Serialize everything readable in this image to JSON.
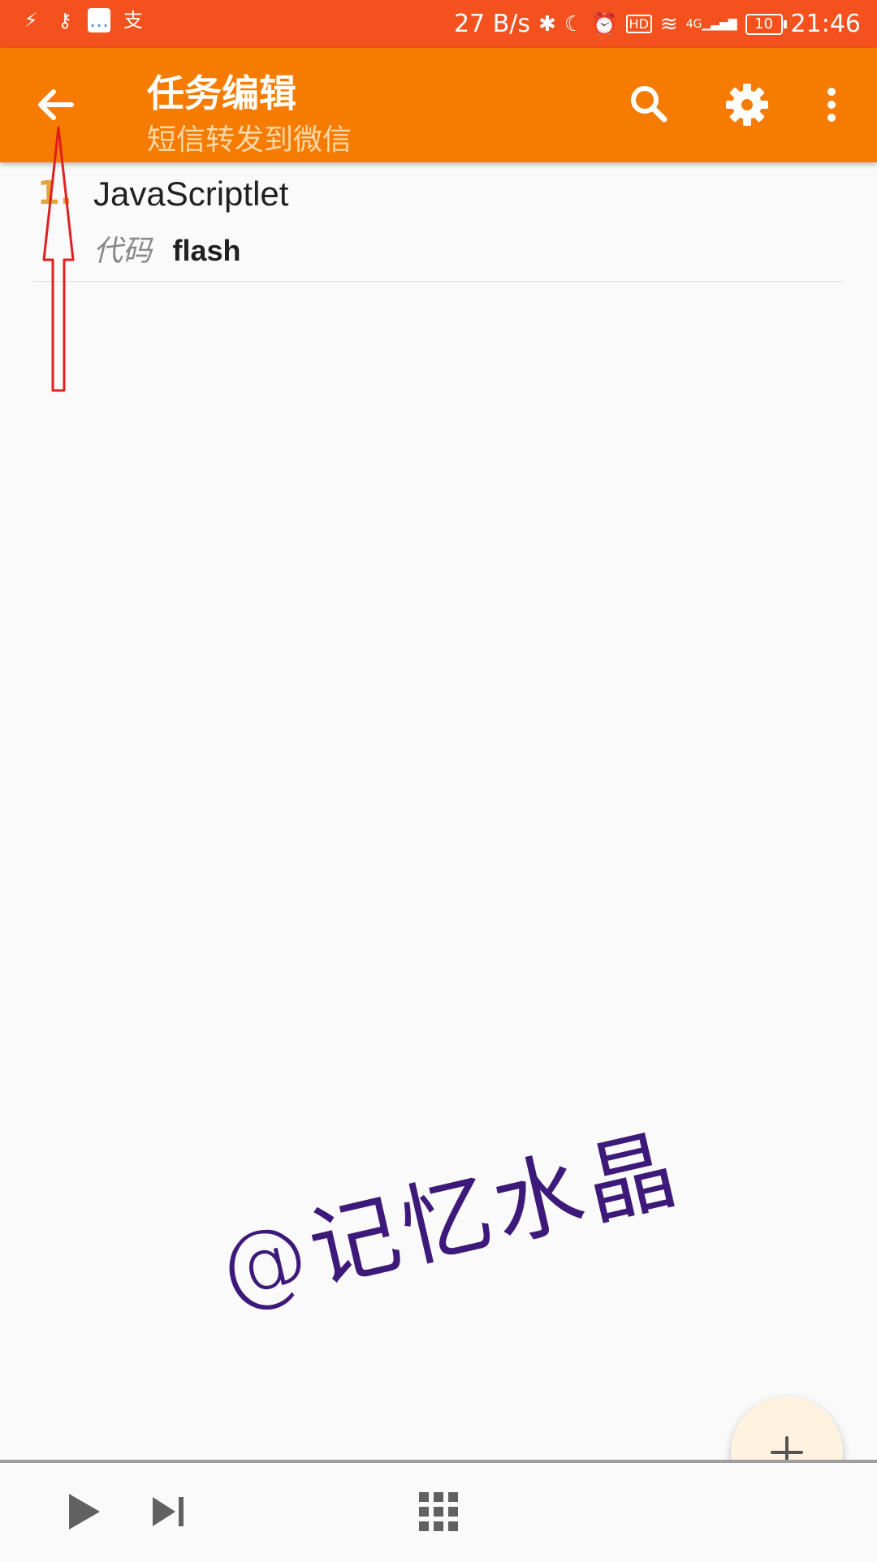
{
  "status_bar": {
    "left_icons": [
      "flash-icon",
      "key-icon",
      "chat-icon",
      "alipay-icon"
    ],
    "net_speed": "27 B/s",
    "network": "4G",
    "battery": "10",
    "time": "21:46",
    "hd_label": "HD"
  },
  "app_bar": {
    "title": "任务编辑",
    "subtitle": "短信转发到微信",
    "icons": [
      "back-arrow-icon",
      "search-icon",
      "gear-icon",
      "more-vert-icon"
    ]
  },
  "actions": [
    {
      "number": "1.",
      "name": "JavaScriptlet",
      "param_label": "代码",
      "param_value": "flash"
    }
  ],
  "watermark": "@记忆水晶",
  "fab": {
    "icon": "plus-icon"
  },
  "bottom_bar": {
    "icons": [
      "play-icon",
      "step-icon",
      "grid-icon"
    ]
  },
  "colors": {
    "status_bar": "#f4511e",
    "app_bar": "#f57c00",
    "annotation": "#e02020",
    "watermark": "#3d1a7a"
  }
}
